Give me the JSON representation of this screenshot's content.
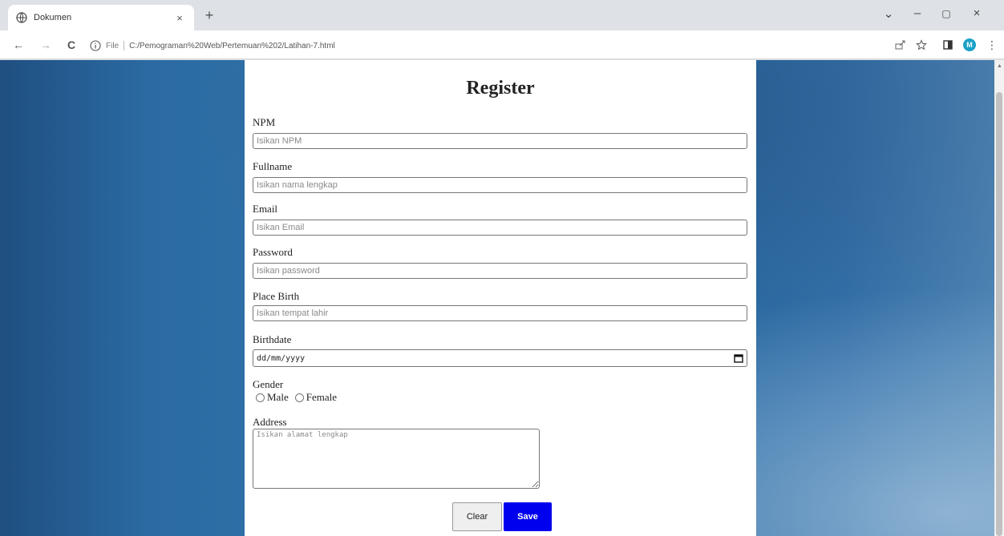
{
  "browser": {
    "tab_title": "Dokumen",
    "tab_close": "×",
    "new_tab": "+",
    "window_controls": [
      "⌄",
      "–",
      "▢",
      "×"
    ],
    "back": "←",
    "forward": "→",
    "reload": "C",
    "scheme_label": "File",
    "url": "C:/Pemograman%20Web/Pertemuan%202/Latihan-7.html",
    "profile_initial": "M",
    "menu": "⋮",
    "icons": [
      "info-icon",
      "share-icon",
      "star-icon",
      "sidepanel-icon",
      "profile-avatar",
      "menu-icon"
    ]
  },
  "form": {
    "heading": "Register",
    "npm": {
      "label": "NPM",
      "placeholder": "Isikan NPM"
    },
    "fullname": {
      "label": "Fullname",
      "placeholder": "Isikan nama lengkap"
    },
    "email": {
      "label": "Email",
      "placeholder": "Isikan Email"
    },
    "password": {
      "label": "Password",
      "placeholder": "Isikan password"
    },
    "place_birth": {
      "label": "Place Birth",
      "placeholder": "Isikan tempat lahir"
    },
    "birthdate": {
      "label": "Birthdate",
      "placeholder": "dd/mm/yyyy"
    },
    "gender": {
      "label": "Gender",
      "options": [
        "Male",
        "Female"
      ]
    },
    "address": {
      "label": "Address",
      "placeholder": "Isikan alamat lengkap"
    },
    "clear_label": "Clear",
    "save_label": "Save"
  },
  "colors": {
    "save_button": "#0000ee",
    "background_blue": "#2a6397",
    "profile_avatar": "#1ba1c8"
  }
}
